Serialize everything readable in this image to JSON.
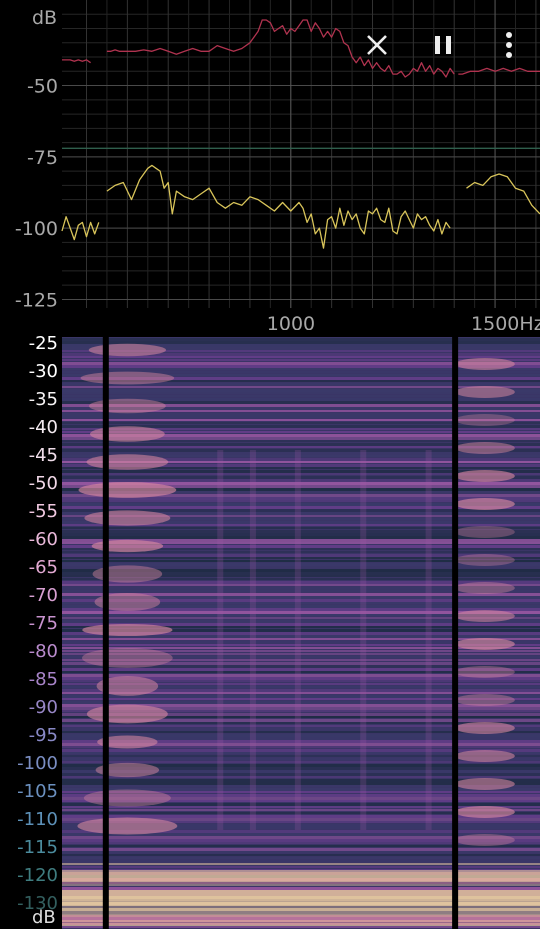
{
  "toolbar": {
    "close_icon": "close-icon",
    "pause_icon": "pause-icon",
    "menu_icon": "more-vert-icon"
  },
  "chart_data": [
    {
      "type": "line",
      "ylabel": "dB",
      "xunit": "Hz",
      "xlim": [
        440,
        1610
      ],
      "ylim": [
        -128,
        -20
      ],
      "y_ticks": [
        -50,
        -75,
        -100,
        -125
      ],
      "x_ticks": [
        1000,
        1500
      ],
      "x_tick_labels": [
        "1000",
        "1500Hz"
      ],
      "threshold_line": -72,
      "grid": true,
      "series": [
        {
          "color": "#b0334f",
          "segments": [
            {
              "x": [
                440,
                450,
                460,
                470,
                480,
                490,
                500,
                510
              ],
              "y": [
                -41,
                -41,
                -41,
                -41.5,
                -41,
                -41.5,
                -41,
                -42
              ]
            },
            {
              "x": [
                550,
                560,
                570,
                580,
                590,
                600,
                620,
                640,
                660,
                680,
                700,
                720,
                740,
                760,
                780,
                800,
                820,
                840,
                860,
                880,
                900,
                920,
                930,
                940,
                950,
                960,
                970,
                980,
                990,
                1000,
                1010,
                1020,
                1030,
                1040,
                1050,
                1060,
                1070,
                1080,
                1090,
                1100,
                1110,
                1120,
                1130,
                1140,
                1150,
                1160,
                1170,
                1180,
                1190,
                1200,
                1210,
                1220,
                1230,
                1240,
                1250,
                1260,
                1270,
                1280,
                1290,
                1300,
                1310,
                1320,
                1330,
                1340,
                1350,
                1360,
                1370,
                1380,
                1390,
                1400
              ],
              "y": [
                -38,
                -38,
                -37.5,
                -38,
                -38,
                -38,
                -38,
                -37.5,
                -38,
                -37,
                -38,
                -39,
                -38,
                -37,
                -38,
                -38,
                -36,
                -37,
                -38,
                -37,
                -35,
                -31,
                -27,
                -27,
                -28,
                -31,
                -30,
                -29,
                -32,
                -30,
                -31,
                -29,
                -27,
                -27,
                -31,
                -28,
                -30,
                -33,
                -31,
                -33,
                -30,
                -31,
                -35,
                -36,
                -40,
                -42,
                -40,
                -43,
                -41,
                -44,
                -42,
                -44,
                -45,
                -43,
                -46,
                -46,
                -45,
                -47,
                -46,
                -44,
                -45,
                -42,
                -45,
                -43,
                -46,
                -44,
                -45,
                -47,
                -44,
                -46
              ]
            },
            {
              "x": [
                1410,
                1420,
                1440,
                1460,
                1480,
                1500,
                1520,
                1540,
                1560,
                1580,
                1600,
                1610
              ],
              "y": [
                -46,
                -46,
                -45,
                -45,
                -44,
                -45,
                -44,
                -45,
                -44,
                -45,
                -45,
                -45
              ]
            }
          ]
        },
        {
          "color": "#d8c45a",
          "segments": [
            {
              "x": [
                440,
                450,
                460,
                470,
                480,
                490,
                500,
                510,
                520,
                530
              ],
              "y": [
                -101,
                -96,
                -100,
                -104,
                -99,
                -98,
                -103,
                -98,
                -102,
                -98
              ]
            },
            {
              "x": [
                550,
                570,
                590,
                610,
                630,
                650,
                660,
                670,
                680,
                690,
                700,
                710,
                720,
                740,
                760,
                780,
                800,
                820,
                840,
                860,
                880,
                900,
                920,
                940,
                960,
                980,
                1000,
                1020,
                1030,
                1040,
                1050,
                1060,
                1070,
                1080,
                1090,
                1100,
                1110,
                1120,
                1130,
                1140,
                1150,
                1160,
                1170,
                1180,
                1190,
                1200,
                1210,
                1220,
                1230,
                1240,
                1250,
                1260,
                1270,
                1280,
                1290,
                1300,
                1310,
                1320,
                1330,
                1340,
                1350,
                1360,
                1370,
                1380,
                1390
              ],
              "y": [
                -87,
                -85,
                -84,
                -90,
                -83,
                -79,
                -78,
                -79,
                -80,
                -86,
                -84,
                -95,
                -87,
                -89,
                -90,
                -88,
                -86,
                -91,
                -93,
                -91,
                -92,
                -89,
                -90,
                -92,
                -94,
                -91,
                -94,
                -91,
                -93,
                -98,
                -95,
                -102,
                -100,
                -107,
                -97,
                -96,
                -100,
                -93,
                -99,
                -94,
                -97,
                -95,
                -100,
                -102,
                -94,
                -95,
                -93,
                -97,
                -98,
                -93,
                -101,
                -102,
                -96,
                -94,
                -97,
                -100,
                -95,
                -97,
                -96,
                -99,
                -101,
                -97,
                -102,
                -98,
                -100
              ]
            },
            {
              "x": [
                1430,
                1450,
                1470,
                1490,
                1510,
                1530,
                1550,
                1570,
                1590,
                1610
              ],
              "y": [
                -86,
                -84,
                -85,
                -82,
                -81,
                -82,
                -86,
                -87,
                -92,
                -95
              ]
            }
          ]
        }
      ]
    },
    {
      "type": "heatmap",
      "ylabel": "dB",
      "color_scale": [
        "#1b2b40",
        "#3a3a6a",
        "#6a3f8f",
        "#a25aa8",
        "#d98aa0",
        "#f2d3a4"
      ],
      "y_ticks": [
        "-25",
        "-30",
        "-35",
        "-40",
        "-45",
        "-50",
        "-55",
        "-60",
        "-65",
        "-70",
        "-75",
        "-80",
        "-85",
        "-90",
        "-95",
        "-100",
        "-105",
        "-110",
        "-115",
        "-120",
        "-130"
      ],
      "gaps_hz": [
        [
          535,
          555
        ],
        [
          1390,
          1410
        ]
      ]
    }
  ]
}
